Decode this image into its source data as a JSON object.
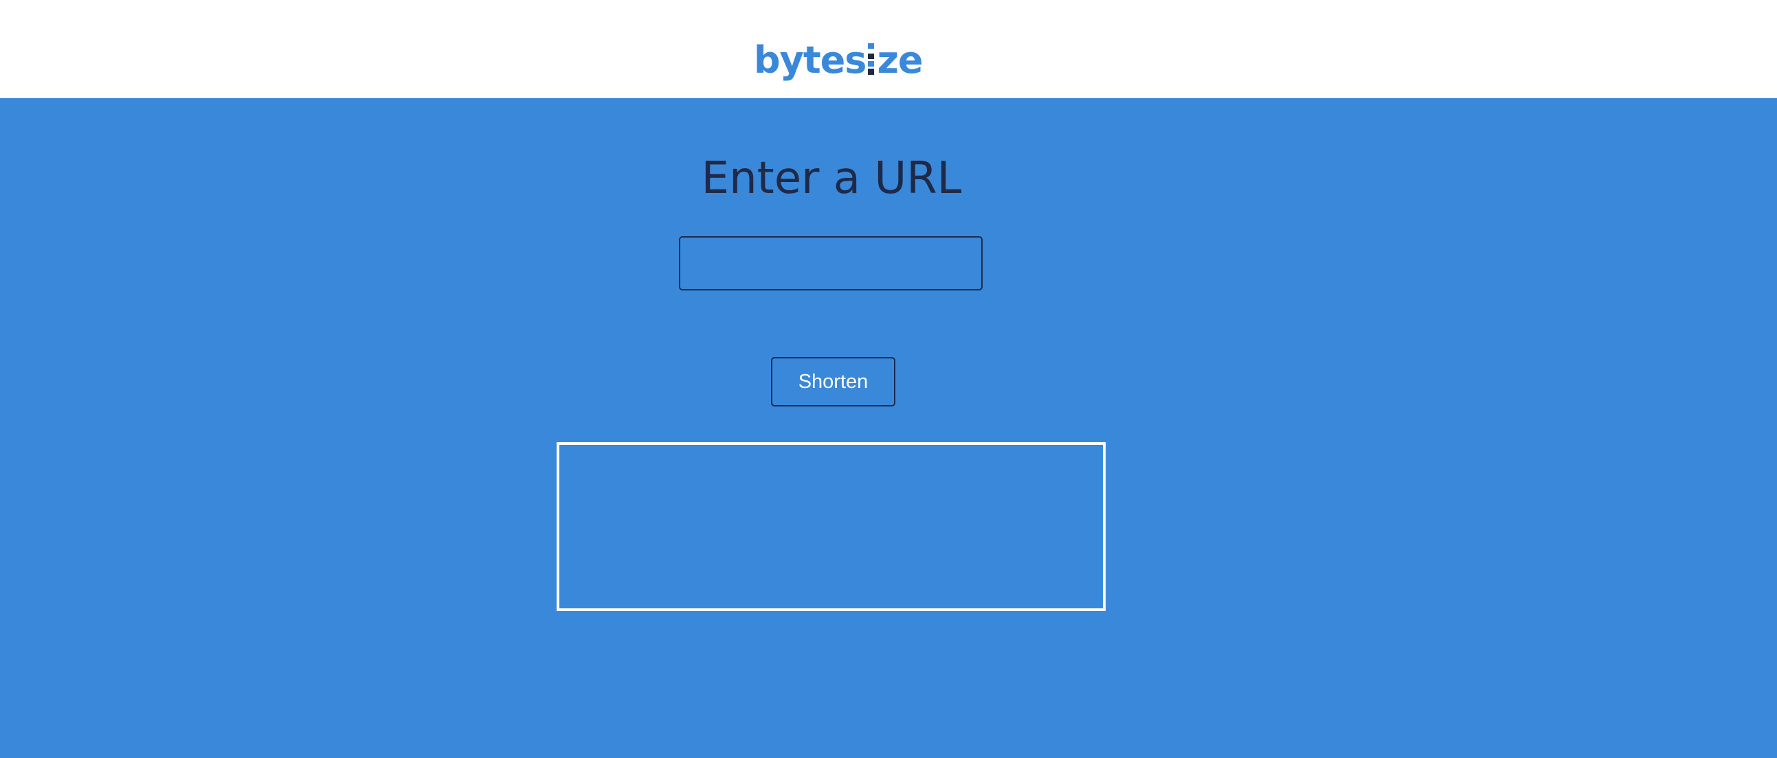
{
  "header": {
    "logo": {
      "part1": "bytes",
      "part2": "ze",
      "brand_color": "#3a88d9",
      "accent_color": "#1f2940"
    }
  },
  "main": {
    "title": "Enter a URL",
    "url_input": {
      "value": "",
      "placeholder": ""
    },
    "shorten_label": "Shorten",
    "result": ""
  },
  "colors": {
    "background": "#3a88d9",
    "header_background": "#ffffff",
    "text_dark": "#1e2a48",
    "button_text": "#ffffff"
  }
}
